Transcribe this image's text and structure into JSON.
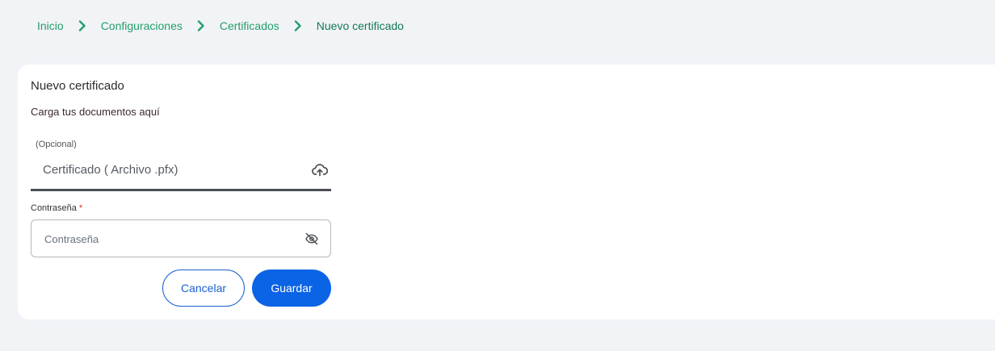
{
  "breadcrumb": {
    "items": [
      "Inicio",
      "Configuraciones",
      "Certificados"
    ],
    "current": "Nuevo certificado"
  },
  "card": {
    "title": "Nuevo certificado",
    "subtitle": "Carga tus documentos aquí"
  },
  "file_field": {
    "hint": "(Opcional)",
    "placeholder": "Certificado ( Archivo .pfx)",
    "icon": "cloud-upload-icon"
  },
  "password_field": {
    "label": "Contraseña",
    "required_mark": "*",
    "placeholder": "Contraseña",
    "icon": "eye-off-icon"
  },
  "buttons": {
    "cancel": "Cancelar",
    "save": "Guardar"
  },
  "colors": {
    "accent_green": "#22a06b",
    "primary_blue": "#0b63e5",
    "background": "#f2f3f7"
  }
}
